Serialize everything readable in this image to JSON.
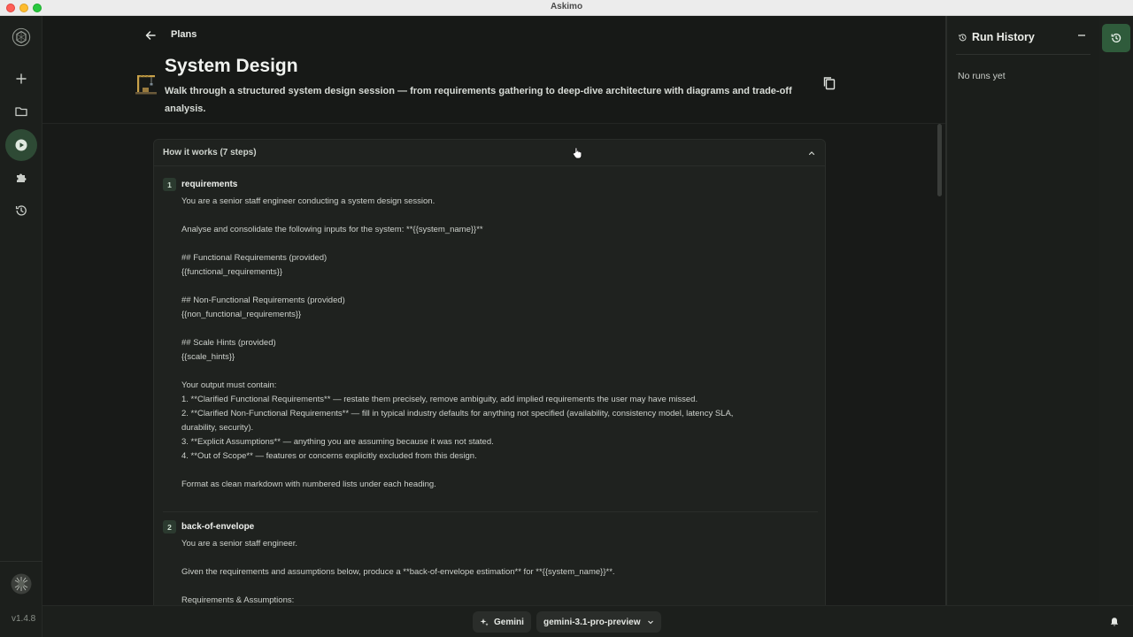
{
  "window": {
    "title": "Askimo"
  },
  "rail": {
    "items": [
      {
        "name": "logo",
        "icon": "app-logo-icon"
      },
      {
        "name": "new",
        "icon": "plus-icon"
      },
      {
        "name": "projects",
        "icon": "folder-icon"
      },
      {
        "name": "plans",
        "icon": "play-icon",
        "active": true
      },
      {
        "name": "extensions",
        "icon": "puzzle-icon"
      },
      {
        "name": "history",
        "icon": "history-icon"
      }
    ],
    "version": "v1.4.8"
  },
  "header": {
    "breadcrumb": "Plans",
    "title": "System Design",
    "description": "Walk through a structured system design session — from requirements gathering to deep-dive architecture with diagrams and trade-off analysis."
  },
  "card": {
    "title": "How it works (7 steps)",
    "steps": [
      {
        "number": "1",
        "title": "requirements",
        "body": "You are a senior staff engineer conducting a system design session.\n\nAnalyse and consolidate the following inputs for the system: **{{system_name}}**\n\n## Functional Requirements (provided)\n{{functional_requirements}}\n\n## Non-Functional Requirements (provided)\n{{non_functional_requirements}}\n\n## Scale Hints (provided)\n{{scale_hints}}\n\nYour output must contain:\n1. **Clarified Functional Requirements** — restate them precisely, remove ambiguity, add implied requirements the user may have missed.\n2. **Clarified Non-Functional Requirements** — fill in typical industry defaults for anything not specified (availability, consistency model, latency SLA,\ndurability, security).\n3. **Explicit Assumptions** — anything you are assuming because it was not stated.\n4. **Out of Scope** — features or concerns explicitly excluded from this design.\n\nFormat as clean markdown with numbered lists under each heading."
      },
      {
        "number": "2",
        "title": "back-of-envelope",
        "body": "You are a senior staff engineer.\n\nGiven the requirements and assumptions below, produce a **back-of-envelope estimation** for **{{system_name}}**.\n\nRequirements & Assumptions:"
      }
    ]
  },
  "runHistory": {
    "title": "Run History",
    "empty": "No runs yet"
  },
  "bottom": {
    "provider": "Gemini",
    "model": "gemini-3.1-pro-preview"
  },
  "colors": {
    "accent": "#2f5b3b",
    "active_rail": "#2e4a35"
  }
}
